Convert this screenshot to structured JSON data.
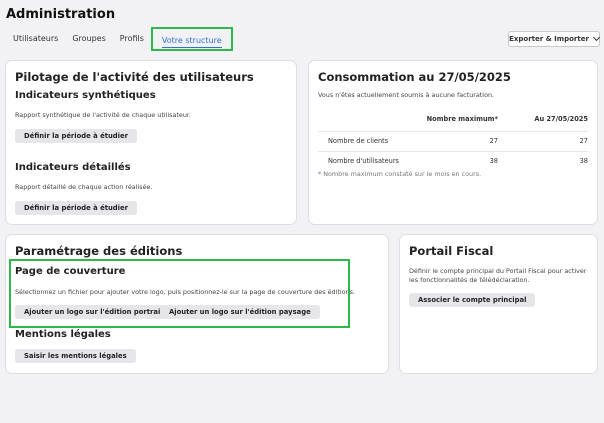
{
  "header": {
    "title": "Administration",
    "tabs": [
      "Utilisateurs",
      "Groupes",
      "Profils",
      "Votre structure"
    ],
    "export_label": "Exporter & Importer"
  },
  "pilotage": {
    "title": "Pilotage de l'activité des utilisateurs",
    "synth_title": "Indicateurs synthétiques",
    "synth_desc": "Rapport synthétique de l'activité de chaque utilisateur.",
    "synth_button": "Définir la période à étudier",
    "detail_title": "Indicateurs détaillés",
    "detail_desc": "Rapport détaillé de chaque action réalisée.",
    "detail_button": "Définir la période à étudier"
  },
  "consommation": {
    "title": "Consommation au 27/05/2025",
    "desc": "Vous n'êtes actuellement soumis à aucune facturation.",
    "columns": [
      "Nombre maximum*",
      "Au 27/05/2025"
    ],
    "rows": [
      {
        "label": "Nombre de clients",
        "max": "27",
        "current": "27"
      },
      {
        "label": "Nombre d'utilisateurs",
        "max": "38",
        "current": "38"
      }
    ],
    "footnote": "* Nombre maximum constaté sur le mois en cours."
  },
  "editions": {
    "title": "Paramétrage des éditions",
    "cover_title": "Page de couverture",
    "cover_desc": "Sélectionnez un fichier pour ajouter votre logo, puis positionnez-le sur la page de couverture des éditions.",
    "portrait_button": "Ajouter un logo sur l'édition portrait",
    "paysage_button": "Ajouter un logo sur l'édition paysage",
    "mentions_title": "Mentions légales",
    "mentions_button": "Saisir les mentions légales"
  },
  "portail": {
    "title": "Portail Fiscal",
    "desc_line1": "Définir le compte principal du Portail Fiscal pour activer",
    "desc_line2": "les fonctionnalités de télédéclaration.",
    "button": "Associer le compte principal"
  }
}
